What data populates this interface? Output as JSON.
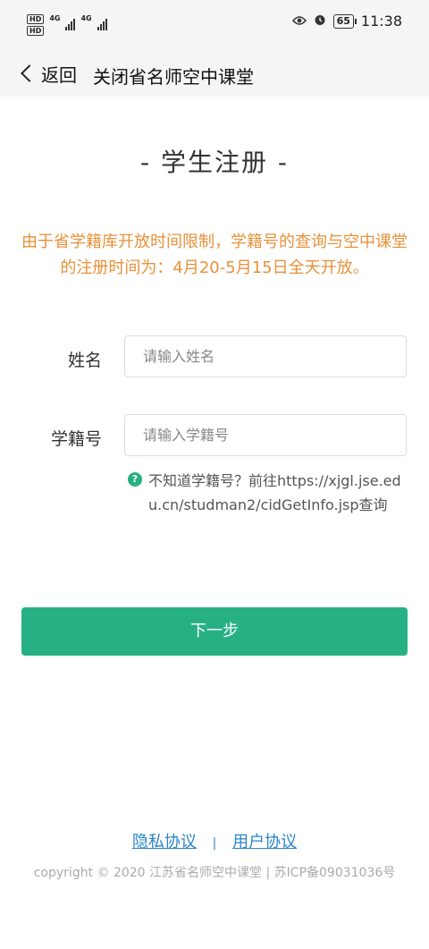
{
  "status_bar": {
    "hd1": "HD",
    "hd2": "HD",
    "net1": "4G",
    "net2": "4G",
    "battery": "65",
    "time": "11:38",
    "icons": [
      "eye-icon",
      "alarm-icon",
      "battery-icon"
    ]
  },
  "nav": {
    "back_label": "返回",
    "close_label": "关闭省名师空中课堂"
  },
  "page": {
    "title": "- 学生注册 -",
    "notice": "由于省学籍库开放时间限制，学籍号的查询与空中课堂的注册时间为：4月20-5月15日全天开放。"
  },
  "form": {
    "name_label": "姓名",
    "name_placeholder": "请输入姓名",
    "name_value": "",
    "student_id_label": "学籍号",
    "student_id_placeholder": "请输入学籍号",
    "student_id_value": "",
    "hint_icon": "?",
    "hint_text": "不知道学籍号？前往https://xjgl.jse.edu.cn/studman2/cidGetInfo.jsp查询",
    "next_button": "下一步"
  },
  "footer": {
    "privacy_link": "隐私协议",
    "separator": "|",
    "user_agreement_link": "用户协议",
    "copyright": "copyright © 2020 江苏省名师空中课堂 | 苏ICP备09031036号"
  },
  "colors": {
    "accent": "#27b083",
    "notice": "#e8913a",
    "link": "#2a86c8"
  }
}
